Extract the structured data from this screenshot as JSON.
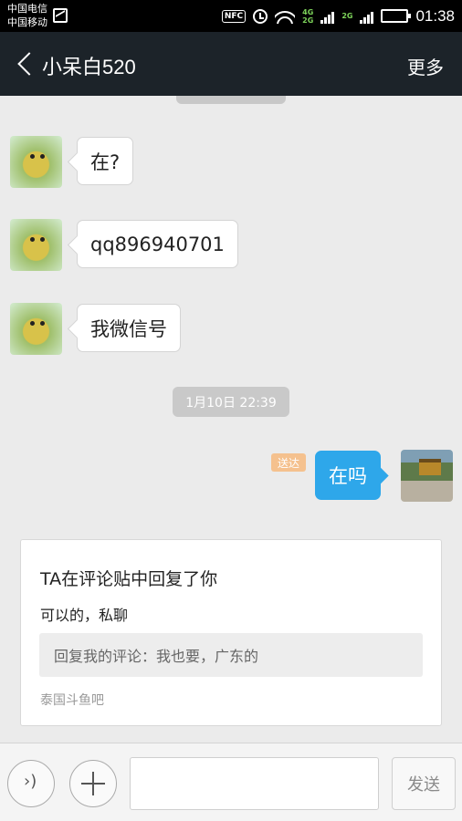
{
  "status_bar": {
    "carrier_1": "中国电信",
    "carrier_2": "中国移动",
    "nfc": "NFC",
    "net_top": "4G",
    "net_bottom": "2G",
    "net_2": "2G",
    "time": "01:38"
  },
  "header": {
    "title": "小呆白520",
    "more_label": "更多"
  },
  "messages": [
    {
      "side": "left",
      "text": "在?"
    },
    {
      "side": "left",
      "text": "qq896940701"
    },
    {
      "side": "left",
      "text": "我微信号"
    },
    {
      "side": "right",
      "text": "在吗",
      "status": "送达"
    }
  ],
  "timestamp": "1月10日 22:39",
  "reply_card": {
    "title": "TA在评论贴中回复了你",
    "reply": "可以的，私聊",
    "quote": "回复我的评论：我也要，广东的",
    "source": "泰国斗鱼吧"
  },
  "input_bar": {
    "placeholder": "",
    "send_label": "发送"
  },
  "colors": {
    "header_bg": "#1c2329",
    "sent_bubble": "#2ea7ea",
    "status_tag": "#f5c18e"
  }
}
